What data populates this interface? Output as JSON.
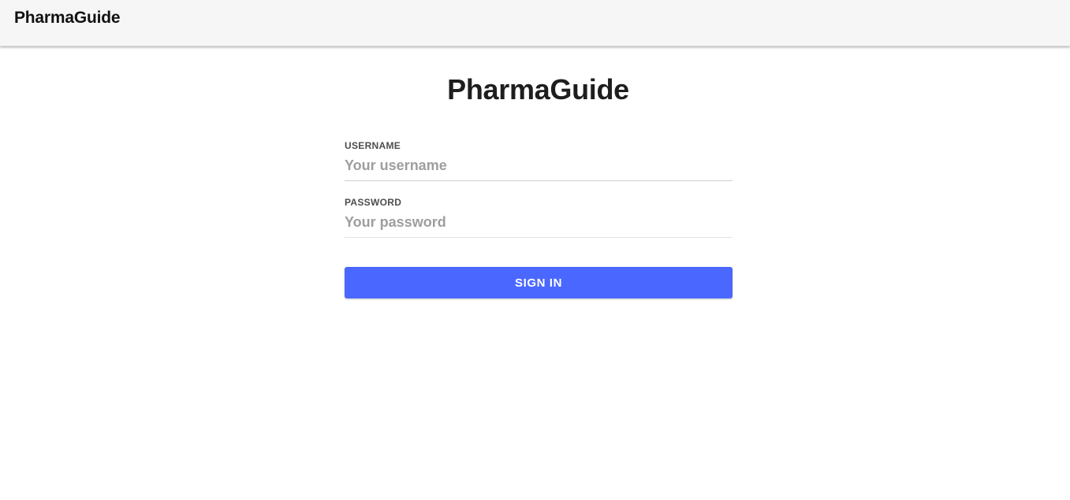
{
  "header": {
    "brand": "PharmaGuide"
  },
  "main": {
    "title": "PharmaGuide"
  },
  "form": {
    "username": {
      "label": "USERNAME",
      "placeholder": "Your username",
      "value": ""
    },
    "password": {
      "label": "PASSWORD",
      "placeholder": "Your password",
      "value": ""
    },
    "submit_label": "SIGN IN"
  },
  "colors": {
    "accent": "#4a68ff",
    "header_bg": "#f6f6f6",
    "text": "#1e1e1e",
    "placeholder": "#9e9e9e"
  }
}
